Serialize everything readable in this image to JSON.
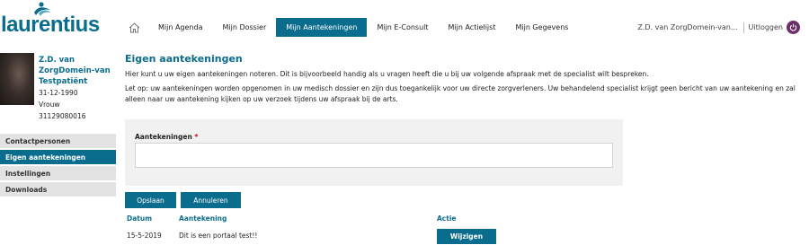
{
  "brand": {
    "name": "laurentius",
    "color": "#0b6d8d",
    "mark_color": "#0b6d8d"
  },
  "nav": {
    "home_icon": "home-icon",
    "items": [
      {
        "label": "Mijn Agenda",
        "active": false
      },
      {
        "label": "Mijn Dossier",
        "active": false
      },
      {
        "label": "Mijn Aantekeningen",
        "active": true
      },
      {
        "label": "Mijn E-Consult",
        "active": false
      },
      {
        "label": "Mijn Actielijst",
        "active": false
      },
      {
        "label": "Mijn Gegevens",
        "active": false
      }
    ]
  },
  "user": {
    "name": "Z.D. van ZorgDomein-van...",
    "logout_label": "Uitloggen",
    "logout_icon": "power-icon",
    "logout_color": "#6d2e67"
  },
  "patient": {
    "name": "Z.D. van ZorgDomein-van Testpatiënt",
    "birthdate": "31-12-1990",
    "gender": "Vrouw",
    "number": "31129080016"
  },
  "sidebar": {
    "items": [
      {
        "label": "Contactpersonen",
        "active": false
      },
      {
        "label": "Eigen aantekeningen",
        "active": true
      },
      {
        "label": "Instellingen",
        "active": false
      },
      {
        "label": "Downloads",
        "active": false
      }
    ]
  },
  "page": {
    "title": "Eigen aantekeningen",
    "intro": "Hier kunt u uw eigen aantekeningen noteren. Dit is bijvoorbeeld handig als u vragen heeft die u bij uw volgende afspraak met de specialist wilt bespreken.",
    "notice": "Let op: uw aantekeningen worden opgenomen in uw medisch dossier en zijn dus toegankelijk voor uw directe zorgverleners. Uw behandelend specialist krijgt geen bericht van uw aantekening en zal alleen naar uw aantekening kijken op uw verzoek tijdens uw afspraak bij de arts."
  },
  "form": {
    "label": "Aantekeningen",
    "required_mark": "*",
    "value": "",
    "placeholder": ""
  },
  "buttons": {
    "save": "Opslaan",
    "cancel": "Annuleren",
    "edit": "Wijzigen"
  },
  "table": {
    "headers": {
      "date": "Datum",
      "note": "Aantekening",
      "action": "Actie"
    },
    "rows": [
      {
        "date": "15-5-2019",
        "note": "Dit is een portaal test!!"
      }
    ]
  }
}
